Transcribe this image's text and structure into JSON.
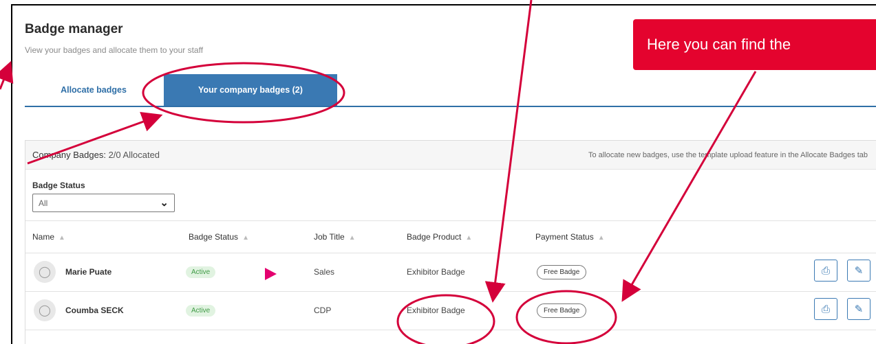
{
  "header": {
    "title": "Badge manager",
    "subtitle": "View your badges and allocate them to your staff"
  },
  "tabs": [
    {
      "label": "Allocate badges",
      "active": false
    },
    {
      "label": "Your company badges (2)",
      "active": true
    }
  ],
  "panel": {
    "title_prefix": "Company Badges:",
    "title_count": "2/0 Allocated",
    "note": "To allocate new badges, use the template upload feature in the Allocate Badges tab"
  },
  "filter": {
    "label": "Badge Status",
    "selected": "All"
  },
  "table": {
    "columns": [
      "Name",
      "Badge Status",
      "Job Title",
      "Badge Product",
      "Payment Status"
    ],
    "rows": [
      {
        "name": "Marie Puate",
        "status": "Active",
        "job": "Sales",
        "product": "Exhibitor Badge",
        "payment": "Free Badge"
      },
      {
        "name": "Coumba SECK",
        "status": "Active",
        "job": "CDP",
        "product": "Exhibitor Badge",
        "payment": "Free Badge"
      }
    ]
  },
  "callout": {
    "text": "Here you can find the"
  },
  "icons": {
    "avatar": "user-icon",
    "print": "print-icon",
    "edit": "pencil-icon",
    "sort": "sort-icon",
    "dropdown": "chevron-down-icon"
  },
  "colors": {
    "primary": "#3a79b3",
    "annotation": "#d4003a",
    "active_pill_bg": "#e1f3e1",
    "active_pill_text": "#3f9a45"
  }
}
